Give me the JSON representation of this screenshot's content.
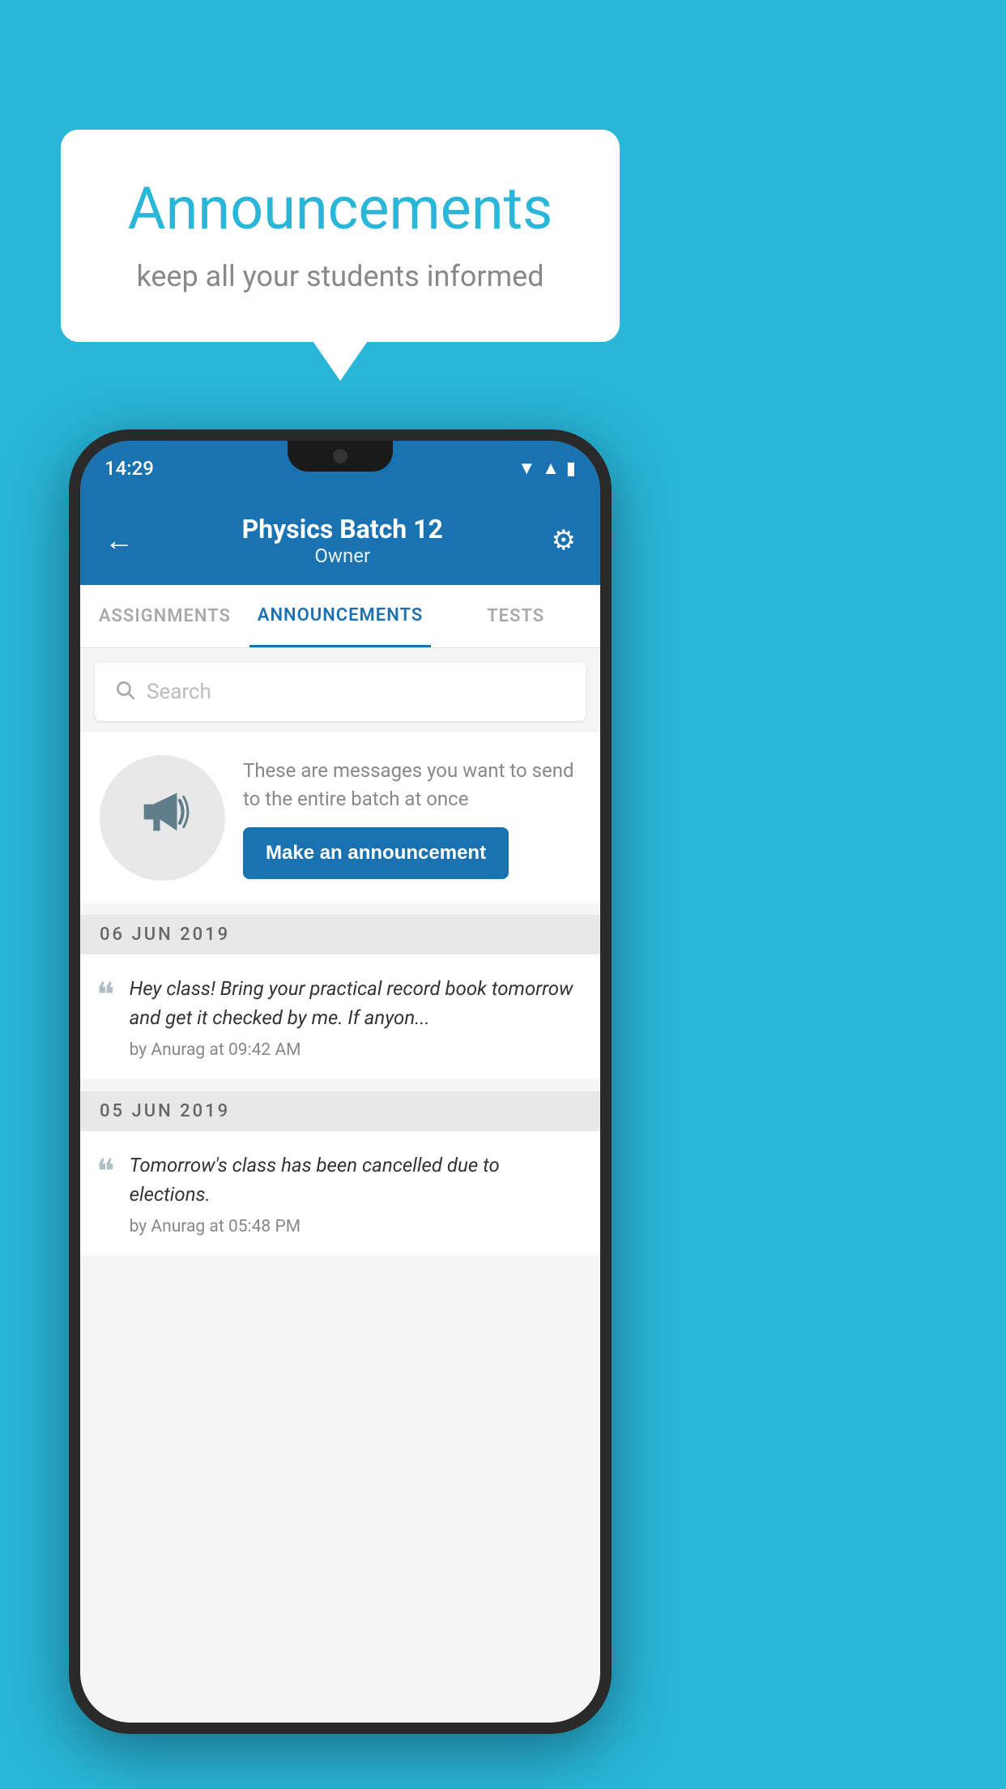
{
  "page": {
    "background_color": "#29b6d8"
  },
  "speech_bubble": {
    "title": "Announcements",
    "subtitle": "keep all your students informed"
  },
  "phone": {
    "status_bar": {
      "time": "14:29"
    },
    "header": {
      "batch_name": "Physics Batch 12",
      "role": "Owner",
      "back_label": "←",
      "gear_label": "⚙"
    },
    "tabs": [
      {
        "label": "ASSIGNMENTS",
        "active": false
      },
      {
        "label": "ANNOUNCEMENTS",
        "active": true
      },
      {
        "label": "TESTS",
        "active": false
      }
    ],
    "search": {
      "placeholder": "Search"
    },
    "promo": {
      "description": "These are messages you want to send to the entire batch at once",
      "button_label": "Make an announcement"
    },
    "announcements": [
      {
        "date": "06  JUN  2019",
        "items": [
          {
            "text": "Hey class! Bring your practical record book tomorrow and get it checked by me. If anyon...",
            "meta": "by Anurag at 09:42 AM"
          }
        ]
      },
      {
        "date": "05  JUN  2019",
        "items": [
          {
            "text": "Tomorrow's class has been cancelled due to elections.",
            "meta": "by Anurag at 05:48 PM"
          }
        ]
      }
    ]
  }
}
